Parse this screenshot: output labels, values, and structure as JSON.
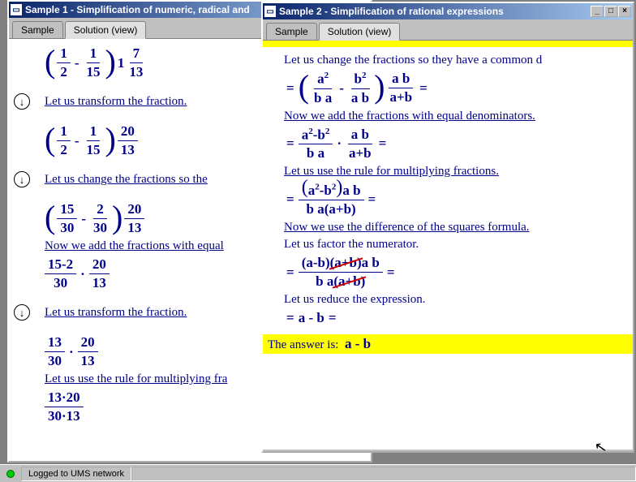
{
  "status": {
    "text": "Logged to UMS network"
  },
  "win1": {
    "title": "Sample 1 - Simplification of numeric, radical and",
    "tabs": {
      "sample": "Sample",
      "solution": "Solution (view)"
    },
    "s1": {
      "f1n": "1",
      "f1d": "2",
      "op": "-",
      "f2n": "1",
      "f2d": "15",
      "whole": "1",
      "f3n": "7",
      "f3d": "13",
      "cap": "Let us transform the fraction."
    },
    "s2": {
      "f1n": "1",
      "f1d": "2",
      "op": "-",
      "f2n": "1",
      "f2d": "15",
      "f3n": "20",
      "f3d": "13",
      "cap": "Let us change the fractions so the"
    },
    "s3": {
      "f1n": "15",
      "f1d": "30",
      "op": "-",
      "f2n": "2",
      "f2d": "30",
      "f3n": "20",
      "f3d": "13",
      "cap": "Now we add the fractions with equal"
    },
    "s4": {
      "f1n": "15-2",
      "f1d": "30",
      "f2n": "20",
      "f2d": "13",
      "cap": "Let us transform the fraction."
    },
    "s5": {
      "f1n": "13",
      "f1d": "30",
      "f2n": "20",
      "f2d": "13",
      "cap": "Let us use the rule for multiplying fra"
    },
    "s6": {
      "f1n": "13·20",
      "f1d": "30·13"
    }
  },
  "win2": {
    "title": "Sample 2 - Simplification of rational expressions",
    "tabs": {
      "sample": "Sample",
      "solution": "Solution (view)"
    },
    "s0": {
      "cap": "Let us change the fractions so they have a common d"
    },
    "s1": {
      "f1n": "a",
      "f1e": "2",
      "f1d": "b a",
      "f2n": "b",
      "f2e": "2",
      "f2d": "a b",
      "f3n": "a b",
      "f3d": "a+b",
      "cap": "Now we add the fractions with equal denominators."
    },
    "s2": {
      "f1n": "a",
      "f1e1": "2",
      "mid": "-b",
      "f1e2": "2",
      "f1d": "b a",
      "f2n": "a b",
      "f2d": "a+b",
      "cap": "Let us use the rule for multiplying fractions."
    },
    "s3": {
      "num_a": "a",
      "num_e1": "2",
      "num_mid": "-b",
      "num_e2": "2",
      "num_tail": "a b",
      "den": "b a(a+b)",
      "cap": "Now we use the difference of the squares formula.",
      "cap2": "Let us factor the numerator."
    },
    "s4": {
      "t1": "(a-b)",
      "t2": "(a+b)",
      "t3": "a b",
      "db": "b a",
      "dt": "(a+b)",
      "cap": "Let us reduce the expression."
    },
    "s5": {
      "expr": "a - b"
    },
    "ans": {
      "label": "The answer is:",
      "val": "a - b"
    }
  }
}
